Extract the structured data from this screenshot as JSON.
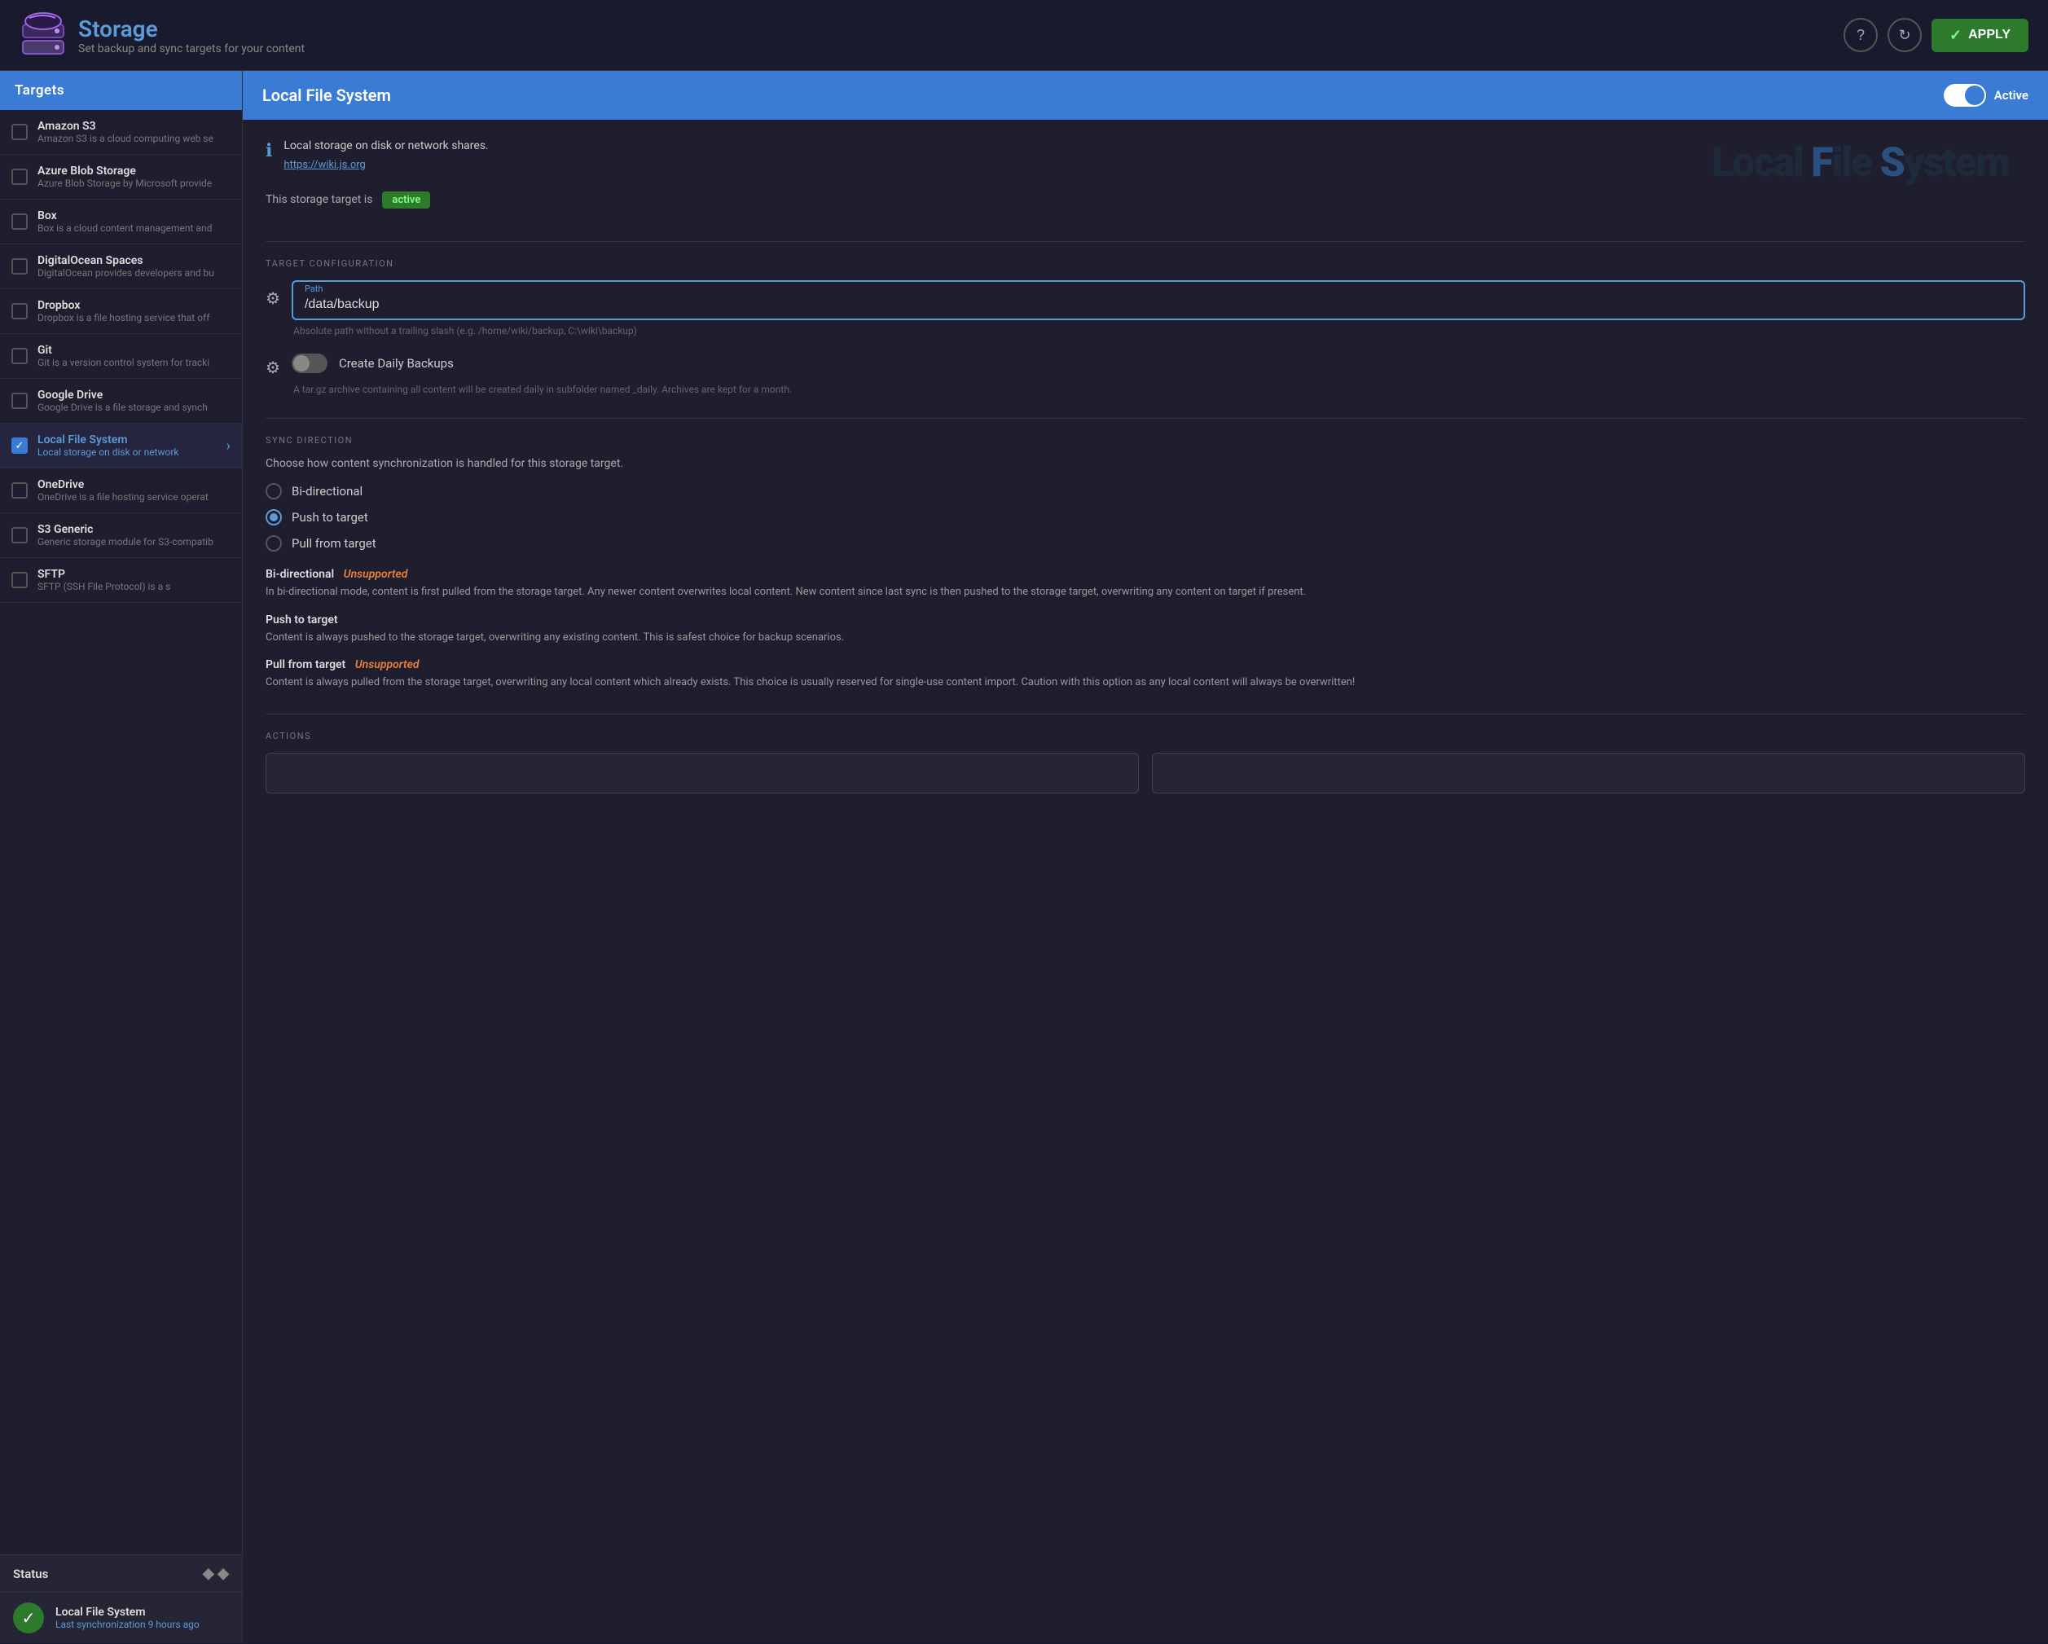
{
  "header": {
    "title": "Storage",
    "subtitle": "Set backup and sync targets for your content",
    "apply_label": "APPLY"
  },
  "sidebar": {
    "title": "Targets",
    "items": [
      {
        "id": "amazon-s3",
        "name": "Amazon S3",
        "desc": "Amazon S3 is a cloud computing web se",
        "active": false,
        "checked": false
      },
      {
        "id": "azure-blob",
        "name": "Azure Blob Storage",
        "desc": "Azure Blob Storage by Microsoft provide",
        "active": false,
        "checked": false
      },
      {
        "id": "box",
        "name": "Box",
        "desc": "Box is a cloud content management and",
        "active": false,
        "checked": false
      },
      {
        "id": "digitalocean",
        "name": "DigitalOcean Spaces",
        "desc": "DigitalOcean provides developers and bu",
        "active": false,
        "checked": false
      },
      {
        "id": "dropbox",
        "name": "Dropbox",
        "desc": "Dropbox is a file hosting service that off",
        "active": false,
        "checked": false
      },
      {
        "id": "git",
        "name": "Git",
        "desc": "Git is a version control system for tracki",
        "active": false,
        "checked": false
      },
      {
        "id": "google-drive",
        "name": "Google Drive",
        "desc": "Google Drive is a file storage and synch",
        "active": false,
        "checked": false
      },
      {
        "id": "local-fs",
        "name": "Local File System",
        "desc": "Local storage on disk or network",
        "active": true,
        "checked": true
      },
      {
        "id": "onedrive",
        "name": "OneDrive",
        "desc": "OneDrive is a file hosting service operat",
        "active": false,
        "checked": false
      },
      {
        "id": "s3-generic",
        "name": "S3 Generic",
        "desc": "Generic storage module for S3-compatib",
        "active": false,
        "checked": false
      },
      {
        "id": "sftp",
        "name": "SFTP",
        "desc": "SFTP (SSH File Protocol) is a s",
        "active": false,
        "checked": false
      }
    ],
    "status": {
      "label": "Status",
      "item_name": "Local File System",
      "item_sub": "Last synchronization 9 hours ago"
    }
  },
  "content": {
    "header_title": "Local File System",
    "toggle_label": "Active",
    "info_text": "Local storage on disk or network shares.",
    "info_link": "https://wiki.js.org",
    "active_badge": "active",
    "status_text": "This storage target is",
    "watermark_pre": "Local ",
    "watermark_f": "F",
    "watermark_mid": "ile ",
    "watermark_s": "S",
    "watermark_post": "ystem",
    "target_config_label": "TARGET CONFIGURATION",
    "path_label": "Path",
    "path_value": "/data/backup",
    "path_hint": "Absolute path without a trailing slash (e.g. /home/wiki/backup, C:\\wiki\\backup)",
    "daily_backup_label": "Create Daily Backups",
    "daily_backup_desc": "A tar.gz archive containing all content will be created daily in subfolder named _daily. Archives are kept for a month.",
    "sync_direction_label": "SYNC DIRECTION",
    "sync_choose": "Choose how content synchronization is handled for this storage target.",
    "radio_options": [
      {
        "id": "bidirectional",
        "label": "Bi-directional",
        "selected": false
      },
      {
        "id": "push",
        "label": "Push to target",
        "selected": true
      },
      {
        "id": "pull",
        "label": "Pull from target",
        "selected": false
      }
    ],
    "sync_infos": [
      {
        "id": "bi",
        "title": "Bi-directional",
        "unsupported": "Unsupported",
        "body": "In bi-directional mode, content is first pulled from the storage target. Any newer content overwrites local content. New content since last sync is then pushed to the storage target, overwriting any content on target if present."
      },
      {
        "id": "push",
        "title": "Push to target",
        "unsupported": null,
        "body": "Content is always pushed to the storage target, overwriting any existing content. This is safest choice for backup scenarios."
      },
      {
        "id": "pull",
        "title": "Pull from target",
        "unsupported": "Unsupported",
        "body": "Content is always pulled from the storage target, overwriting any local content which already exists. This choice is usually reserved for single-use content import. Caution with this option as any local content will always be overwritten!"
      }
    ],
    "actions_label": "ACTIONS"
  }
}
